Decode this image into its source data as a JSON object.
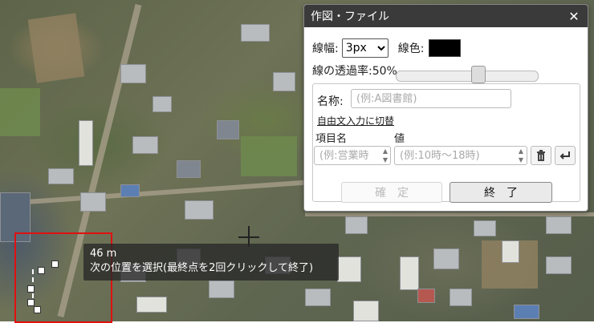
{
  "map": {
    "measurement": "46 m",
    "instruction": "次の位置を選択(最終点を2回クリックして終了)"
  },
  "dialog": {
    "title": "作図・ファイル",
    "close_glyph": "✕",
    "line_width_label": "線幅:",
    "line_width_value": "3px",
    "line_color_label": "線色:",
    "line_color": "#000000",
    "opacity_label": "線の透過率:50%",
    "opacity_value": 0.5,
    "name_label": "名称:",
    "name_placeholder": "(例:A図書館)",
    "free_input_link": "自由文入力に切替",
    "item_name_header": "項目名",
    "value_header": "値",
    "item_placeholder": "(例:営業時",
    "value_placeholder": "(例:10時～18時)",
    "delete_icon": "trash-icon",
    "enter_icon": "return-icon",
    "confirm_label": "確　定",
    "finish_label": "終　了"
  }
}
